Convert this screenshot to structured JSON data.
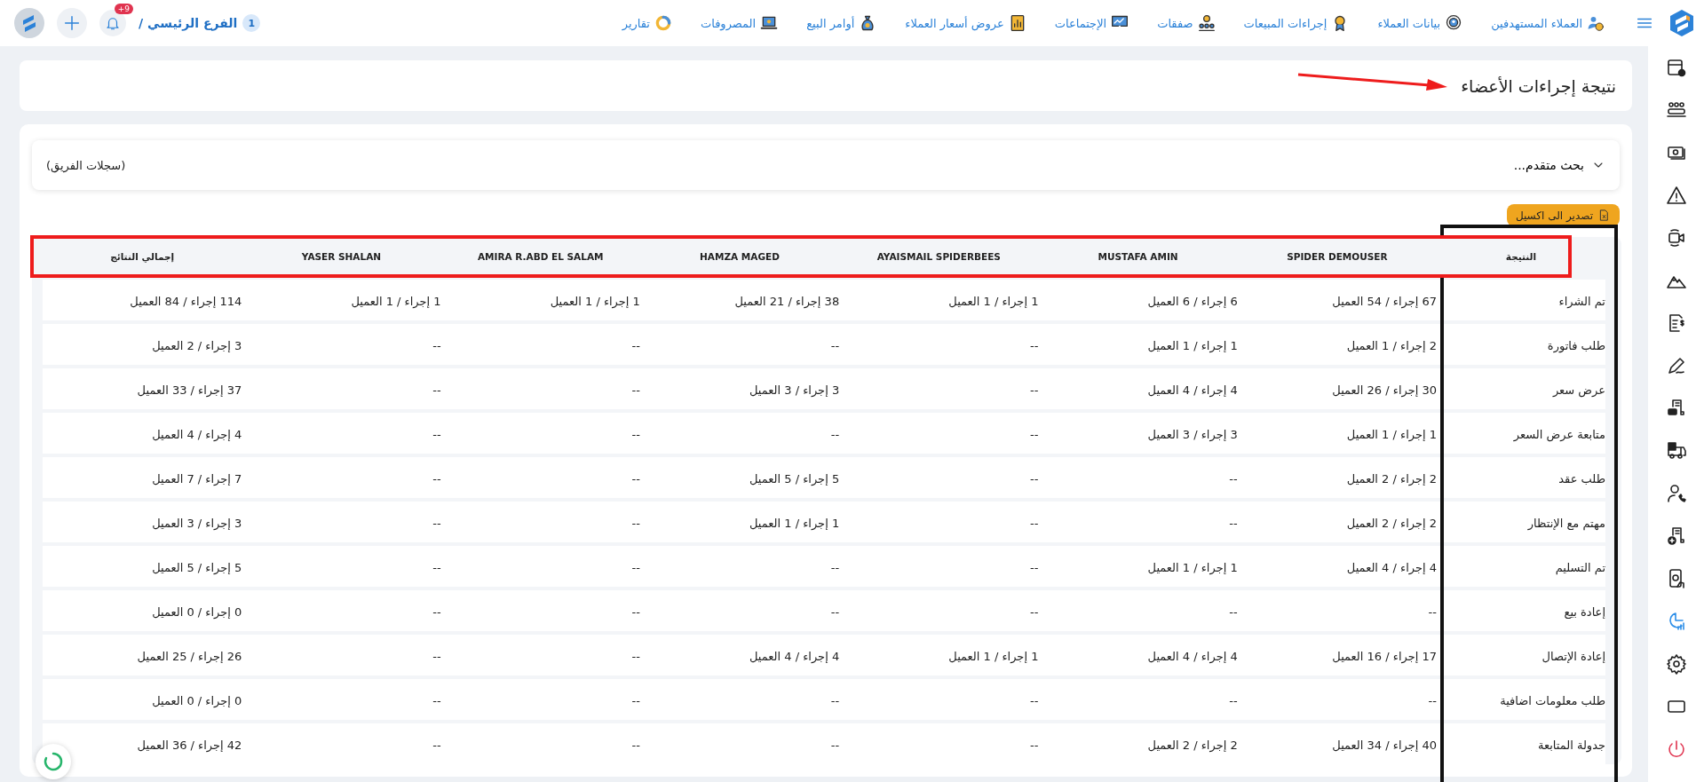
{
  "top_bar": {
    "nav_items": [
      {
        "label": "العملاء المستهدفين"
      },
      {
        "label": "بيانات العملاء"
      },
      {
        "label": "إجراءات المبيعات"
      },
      {
        "label": "صفقات"
      },
      {
        "label": "الإجتماعات"
      },
      {
        "label": "عروض أسعار العملاء"
      },
      {
        "label": "أوامر البيع"
      },
      {
        "label": "المصروفات"
      },
      {
        "label": "تقارير"
      }
    ],
    "branch_count": "1",
    "branch": "الفرع الرئيسي /",
    "notification_badge": "+9"
  },
  "sidebar": {
    "items": [
      {
        "selected": false
      },
      {
        "selected": false
      },
      {
        "selected": false
      },
      {
        "selected": false
      },
      {
        "selected": false
      },
      {
        "selected": false
      },
      {
        "selected": false
      },
      {
        "selected": false
      },
      {
        "selected": false
      },
      {
        "selected": false
      },
      {
        "selected": false
      },
      {
        "selected": false
      },
      {
        "selected": false
      },
      {
        "selected": true
      },
      {
        "selected": false
      },
      {
        "selected": false
      },
      {
        "selected": false
      }
    ]
  },
  "page_title": "نتيجة إجراءات الأعضاء",
  "filter": {
    "label": "بحث متقدم...",
    "expanded": false,
    "scope": "(سجلات الفريق)"
  },
  "export_button": "تصدير الى اكسيل",
  "table": {
    "columns": [
      "النتيجة",
      "SPIDER DEMOUSER",
      "MUSTAFA AMIN",
      "AYAISMAIL SPIDERBEES",
      "HAMZA MAGED",
      "AMIRA R.ABD EL SALAM",
      "YASER SHALAN",
      "إجمالي النتائج"
    ],
    "rows": [
      [
        "تم الشراء",
        "67 إجراء / 54 العميل",
        "6 إجراء / 6 العميل",
        "1 إجراء / 1 العميل",
        "38 إجراء / 21 العميل",
        "1 إجراء / 1 العميل",
        "1 إجراء / 1 العميل",
        "114 إجراء / 84 العميل"
      ],
      [
        "طلب فاتورة",
        "2 إجراء / 1 العميل",
        "1 إجراء / 1 العميل",
        "--",
        "--",
        "--",
        "--",
        "3 إجراء / 2 العميل"
      ],
      [
        "عرض سعر",
        "30 إجراء / 26 العميل",
        "4 إجراء / 4 العميل",
        "--",
        "3 إجراء / 3 العميل",
        "--",
        "--",
        "37 إجراء / 33 العميل"
      ],
      [
        "متابعة عرض السعر",
        "1 إجراء / 1 العميل",
        "3 إجراء / 3 العميل",
        "--",
        "--",
        "--",
        "--",
        "4 إجراء / 4 العميل"
      ],
      [
        "طلب عقد",
        "2 إجراء / 2 العميل",
        "--",
        "--",
        "5 إجراء / 5 العميل",
        "--",
        "--",
        "7 إجراء / 7 العميل"
      ],
      [
        "مهتم مع الإنتظار",
        "2 إجراء / 2 العميل",
        "--",
        "--",
        "1 إجراء / 1 العميل",
        "--",
        "--",
        "3 إجراء / 3 العميل"
      ],
      [
        "تم التسليم",
        "4 إجراء / 4 العميل",
        "1 إجراء / 1 العميل",
        "--",
        "--",
        "--",
        "--",
        "5 إجراء / 5 العميل"
      ],
      [
        "إعادة بيع",
        "--",
        "--",
        "--",
        "--",
        "--",
        "--",
        "0 إجراء / 0 العميل"
      ],
      [
        "إعادة الإتصال",
        "17 إجراء / 16 العميل",
        "4 إجراء / 4 العميل",
        "1 إجراء / 1 العميل",
        "4 إجراء / 4 العميل",
        "--",
        "--",
        "26 إجراء / 25 العميل"
      ],
      [
        "طلب معلومات اضافية",
        "--",
        "--",
        "--",
        "--",
        "--",
        "--",
        "0 إجراء / 0 العميل"
      ],
      [
        "جدولة المتابعة",
        "40 إجراء / 34 العميل",
        "2 إجراء / 2 العميل",
        "--",
        "--",
        "--",
        "--",
        "42 إجراء / 36 العميل"
      ]
    ]
  }
}
